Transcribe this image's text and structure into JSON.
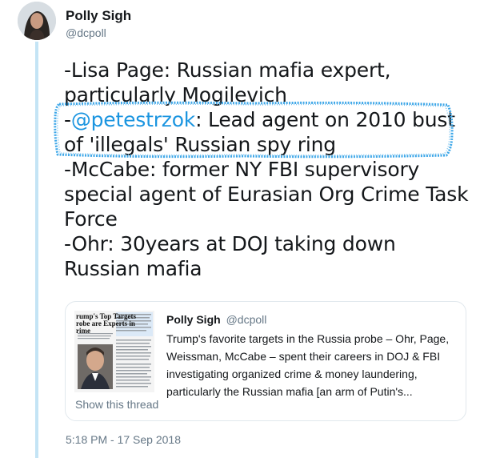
{
  "author": {
    "name": "Polly Sigh",
    "handle": "@dcpoll"
  },
  "tweet": {
    "lines": [
      {
        "prefix": "-Lisa Page: Russian mafia expert,",
        "mention": "",
        "suffix": ""
      },
      {
        "prefix": "particularly Mogilevich",
        "mention": "",
        "suffix": ""
      },
      {
        "prefix": "-",
        "mention": "@petestrzok",
        "suffix": ": Lead agent on 2010 bust"
      },
      {
        "prefix": "of 'illegals' Russian spy ring",
        "mention": "",
        "suffix": ""
      },
      {
        "prefix": "-McCabe: former NY FBI supervisory",
        "mention": "",
        "suffix": ""
      },
      {
        "prefix": "special agent of Eurasian Org Crime Task",
        "mention": "",
        "suffix": ""
      },
      {
        "prefix": "Force",
        "mention": "",
        "suffix": ""
      },
      {
        "prefix": "-Ohr: 30years at DOJ taking down",
        "mention": "",
        "suffix": ""
      },
      {
        "prefix": "Russian mafia",
        "mention": "",
        "suffix": ""
      }
    ],
    "timestamp": "5:18 PM - 17 Sep 2018"
  },
  "quote": {
    "name": "Polly Sigh",
    "handle": "@dcpoll",
    "text_lines": [
      "Trump's favorite targets in the Russia probe – Ohr, Page,",
      "Weissman, McCabe – spent their careers in DOJ & FBI",
      "investigating organized crime & money laundering,",
      "particularly the Russian mafia [an arm of Putin's..."
    ],
    "show_thread": "Show this thread",
    "thumbnail_headline": [
      "rump's Top Targets",
      "robe are Experts in",
      "rime"
    ]
  },
  "colors": {
    "mention": "#1b95e0",
    "highlight": "#3ea7e8",
    "thread_line": "#c4e4f5",
    "secondary_text": "#657786"
  },
  "icons": {
    "avatar": "author-avatar"
  }
}
